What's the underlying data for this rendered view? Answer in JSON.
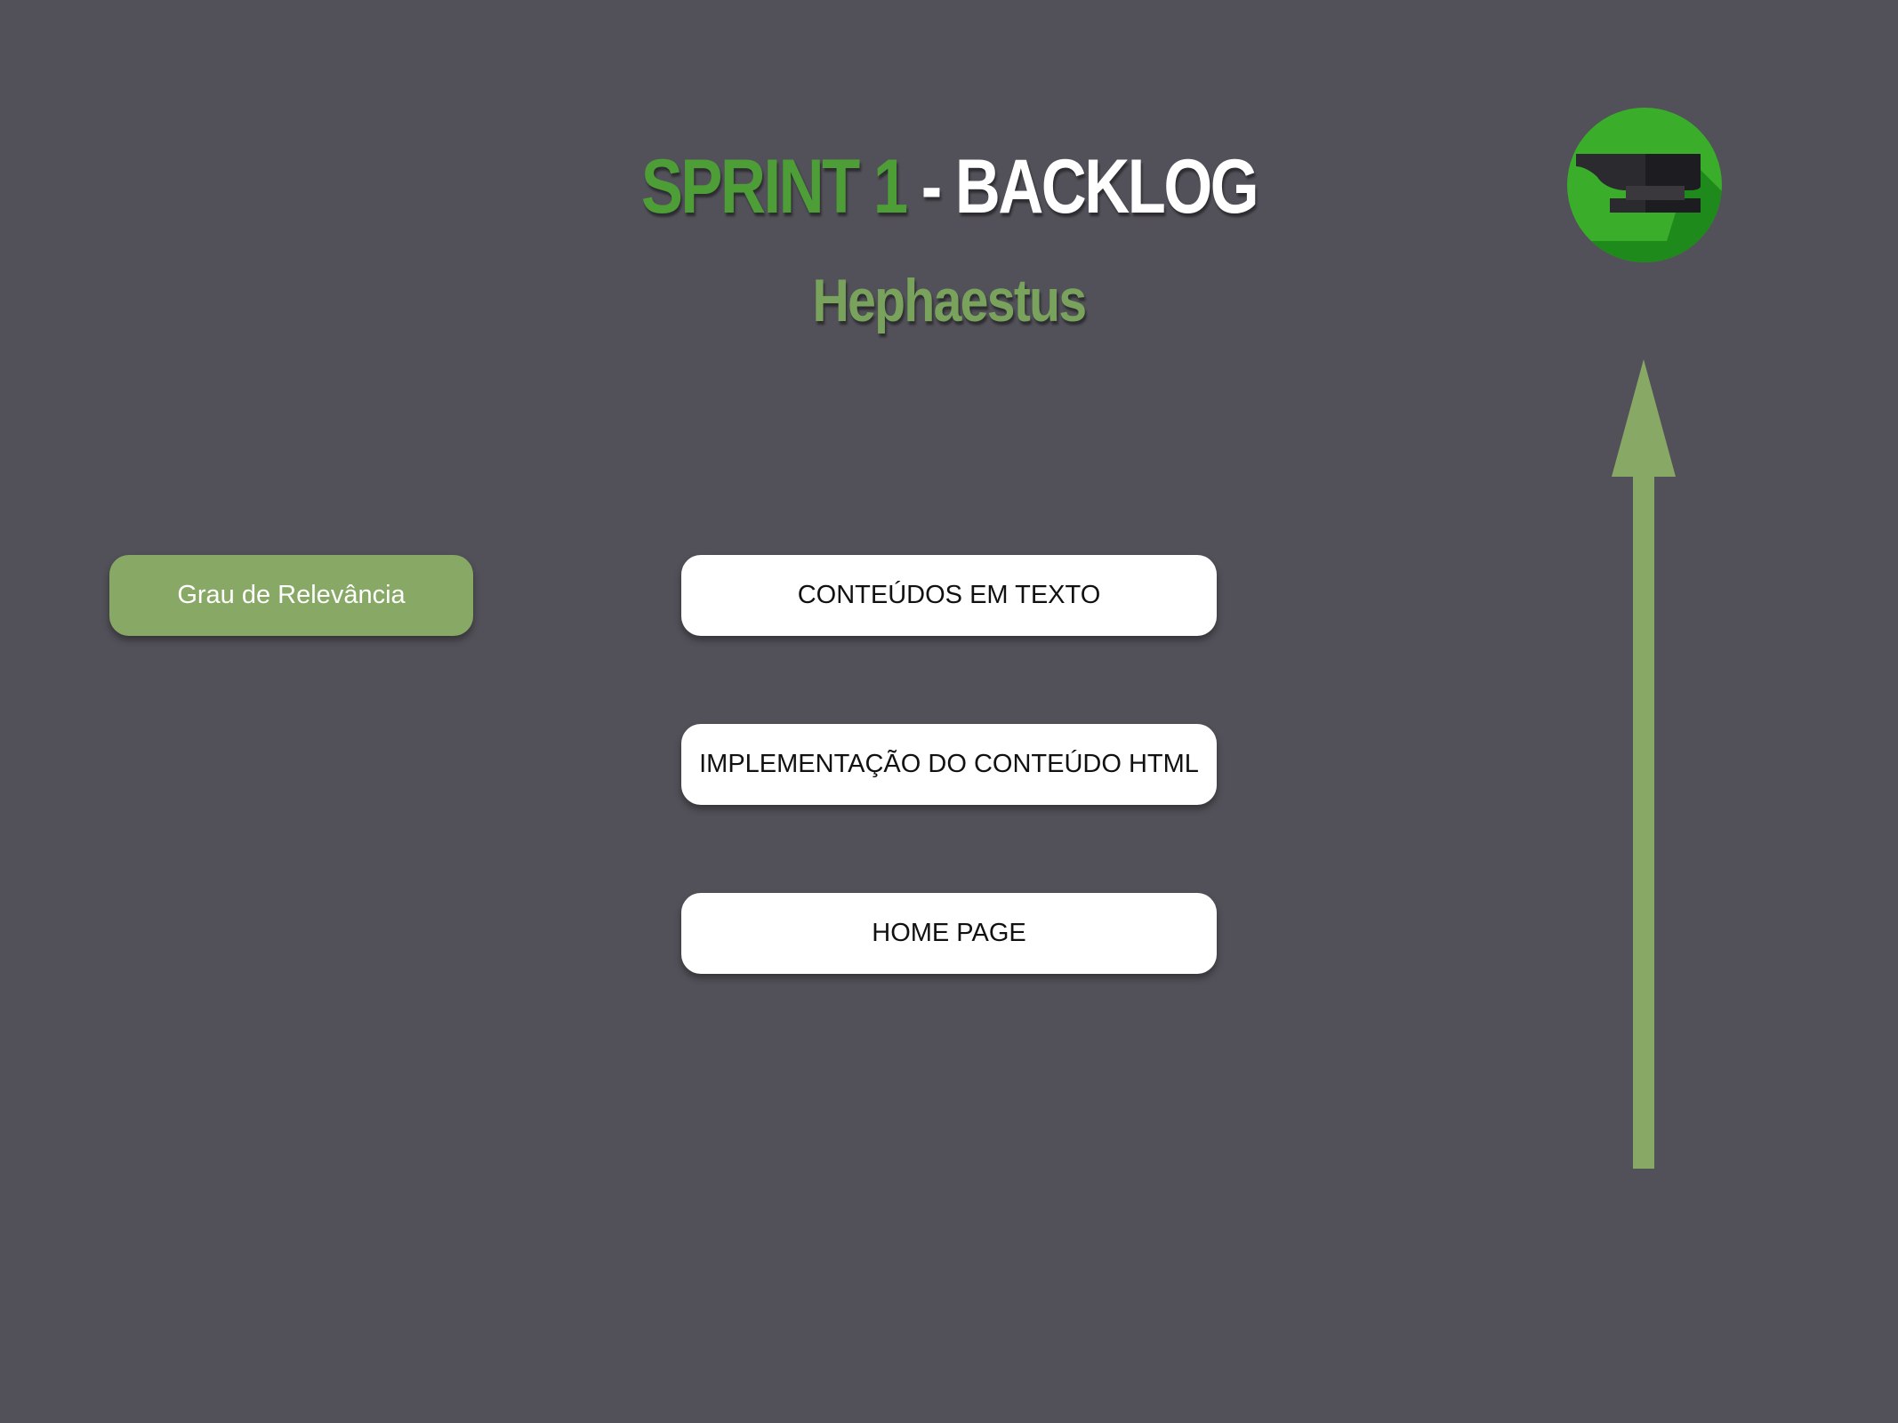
{
  "header": {
    "title_part1": "SPRINT 1",
    "title_part2": " - BACKLOG",
    "subtitle": "Hephaestus"
  },
  "logo": {
    "icon": "anvil-icon",
    "background_color": "#3aad2a"
  },
  "relevance_label": "Grau de Relevância",
  "backlog_items": [
    {
      "label": "CONTEÚDOS EM TEXTO"
    },
    {
      "label": "IMPLEMENTAÇÃO DO CONTEÚDO HTML"
    },
    {
      "label": "HOME PAGE"
    }
  ],
  "arrow": {
    "icon": "arrow-up-icon",
    "color": "#88a865"
  },
  "colors": {
    "background": "#525058",
    "accent_green": "#4e9e38",
    "subtitle_green": "#79a35c",
    "card_white": "#ffffff"
  }
}
